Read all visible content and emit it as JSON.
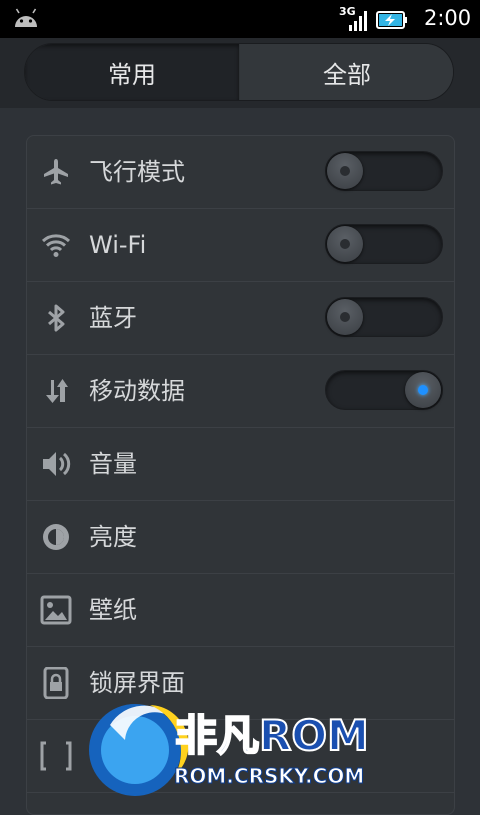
{
  "status_bar": {
    "network": "3G",
    "time": "2:00"
  },
  "tabs": [
    {
      "label": "常用",
      "active": true
    },
    {
      "label": "全部",
      "active": false
    }
  ],
  "settings": [
    {
      "label": "飞行模式",
      "icon": "airplane-icon",
      "toggle": false
    },
    {
      "label": "Wi-Fi",
      "icon": "wifi-icon",
      "toggle": false
    },
    {
      "label": "蓝牙",
      "icon": "bluetooth-icon",
      "toggle": false
    },
    {
      "label": "移动数据",
      "icon": "mobile-data-icon",
      "toggle": true
    },
    {
      "label": "音量",
      "icon": "volume-icon"
    },
    {
      "label": "亮度",
      "icon": "brightness-icon"
    },
    {
      "label": "壁纸",
      "icon": "wallpaper-icon"
    },
    {
      "label": "锁屏界面",
      "icon": "lock-screen-icon"
    },
    {
      "label": "",
      "icon": "screenshot-icon"
    }
  ],
  "watermark": {
    "brand": "非凡ROM",
    "url": "ROM.CRSKY.COM"
  },
  "colors": {
    "accent": "#1e90ff",
    "list_bg": "#303438",
    "header_bg": "#25282c"
  }
}
